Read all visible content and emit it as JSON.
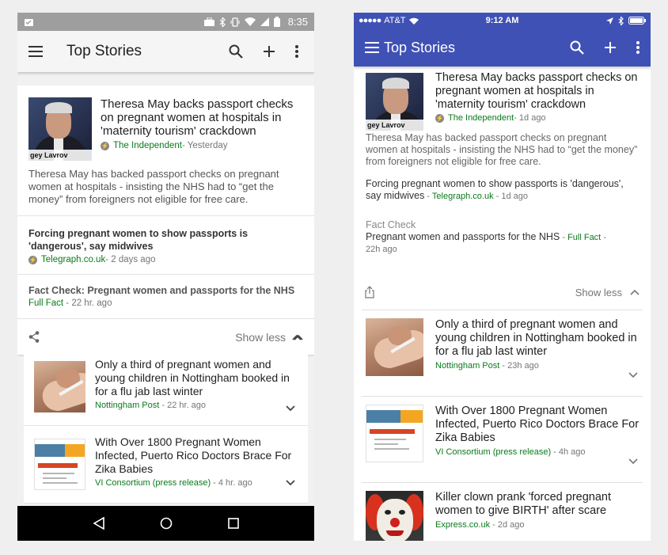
{
  "android": {
    "status_time": "8:35",
    "title": "Top Stories",
    "main_story": {
      "headline": "Theresa May backs passport checks on pregnant women at hospitals in 'maternity tourism' crackdown",
      "thumb_caption": "gey Lavrov",
      "source": "The Independent",
      "time": " - Yesterday",
      "snippet": "Theresa May has backed passport checks on pregnant women at hospitals - insisting the NHS had to “get the money” from foreigners not eligible for free care."
    },
    "related": {
      "headline": "Forcing pregnant women to show passports is 'dangerous', say midwives",
      "source": "Telegraph.co.uk",
      "time": " - 2 days ago"
    },
    "fact_check": {
      "label": "Fact Check:",
      "headline": " Pregnant women and passports for the NHS",
      "source": "Full Fact",
      "time": " - 22 hr. ago"
    },
    "show_less": "Show less",
    "items": [
      {
        "headline": "Only a third of pregnant women and young children in Nottingham booked in for a flu jab last winter",
        "source": "Nottingham Post",
        "time": " - 22 hr. ago"
      },
      {
        "headline": "With Over 1800 Pregnant Women Infected, Puerto Rico Doctors Brace For Zika Babies",
        "source": "VI Consortium (press release)",
        "time": " - 4 hr. ago"
      }
    ]
  },
  "ios": {
    "carrier": "AT&T",
    "status_time": "9:12 AM",
    "title": "Top Stories",
    "main_story": {
      "headline": "Theresa May backs passport checks on pregnant women at hospitals in 'maternity tourism' crackdown",
      "thumb_caption": "gey Lavrov",
      "source": "The Independent",
      "time": " - 1d ago",
      "snippet": "Theresa May has backed passport checks on pregnant women at hospitals - insisting the NHS had to “get the money” from foreigners not eligible for free care."
    },
    "related": {
      "headline": "Forcing pregnant women to show passports is 'dangerous', say midwives",
      "source": "Telegraph.co.uk",
      "time": " - 1d ago"
    },
    "fact_check": {
      "label": "Fact Check",
      "headline": "Pregnant women and passports for the NHS",
      "source": "Full Fact",
      "time": "22h ago"
    },
    "show_less": "Show less",
    "items": [
      {
        "headline": "Only a third of pregnant women and young children in Nottingham booked in for a flu jab last winter",
        "source": "Nottingham Post",
        "time": " - 23h ago"
      },
      {
        "headline": "With Over 1800 Pregnant Women Infected, Puerto Rico Doctors Brace For Zika Babies",
        "source": "VI Consortium (press release)",
        "time": " - 4h ago"
      },
      {
        "headline": "Killer clown prank 'forced pregnant women to give BIRTH' after scare",
        "source": "Express.co.uk",
        "time": " - 2d ago"
      }
    ]
  },
  "colors": {
    "source_green": "#0a7a1c",
    "ios_bar": "#3f51b5"
  }
}
